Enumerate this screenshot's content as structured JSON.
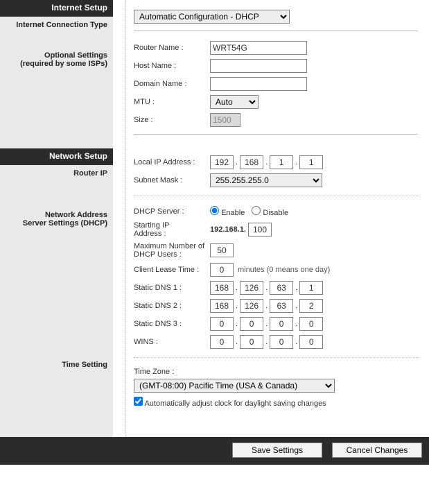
{
  "sidebar": {
    "internet_setup": "Internet Setup",
    "internet_conn_type": "Internet Connection Type",
    "optional_settings_l1": "Optional Settings",
    "optional_settings_l2": "(required by some ISPs)",
    "network_setup": "Network Setup",
    "router_ip": "Router IP",
    "nass_l1": "Network Address",
    "nass_l2": "Server Settings (DHCP)",
    "time_setting": "Time Setting"
  },
  "conn_type": {
    "value": "Automatic Configuration - DHCP"
  },
  "optional": {
    "router_name_label": "Router Name :",
    "router_name_value": "WRT54G",
    "host_name_label": "Host Name :",
    "host_name_value": "",
    "domain_name_label": "Domain Name :",
    "domain_name_value": "",
    "mtu_label": "MTU :",
    "mtu_value": "Auto",
    "size_label": "Size :",
    "size_value": "1500"
  },
  "router_ip": {
    "local_ip_label": "Local IP Address :",
    "local_ip": [
      "192",
      "168",
      "1",
      "1"
    ],
    "subnet_label": "Subnet Mask :",
    "subnet_value": "255.255.255.0"
  },
  "dhcp": {
    "server_label": "DHCP Server :",
    "enable_label": "Enable",
    "disable_label": "Disable",
    "starting_ip_label_l1": "Starting IP",
    "starting_ip_label_l2": "Address :",
    "starting_ip_prefix": "192.168.1.",
    "starting_ip_last": "100",
    "max_users_label_l1": "Maximum Number of",
    "max_users_label_l2": "DHCP Users :",
    "max_users_value": "50",
    "lease_label": "Client Lease Time :",
    "lease_value": "0",
    "lease_suffix": "minutes (0 means one day)",
    "sdns1_label": "Static DNS 1 :",
    "sdns1": [
      "168",
      "126",
      "63",
      "1"
    ],
    "sdns2_label": "Static DNS 2 :",
    "sdns2": [
      "168",
      "126",
      "63",
      "2"
    ],
    "sdns3_label": "Static DNS 3 :",
    "sdns3": [
      "0",
      "0",
      "0",
      "0"
    ],
    "wins_label": "WINS :",
    "wins": [
      "0",
      "0",
      "0",
      "0"
    ]
  },
  "time": {
    "tz_label": "Time Zone :",
    "tz_value": "(GMT-08:00) Pacific Time (USA & Canada)",
    "auto_dst_label": "Automatically adjust clock for daylight saving changes"
  },
  "footer": {
    "save": "Save Settings",
    "cancel": "Cancel Changes"
  }
}
